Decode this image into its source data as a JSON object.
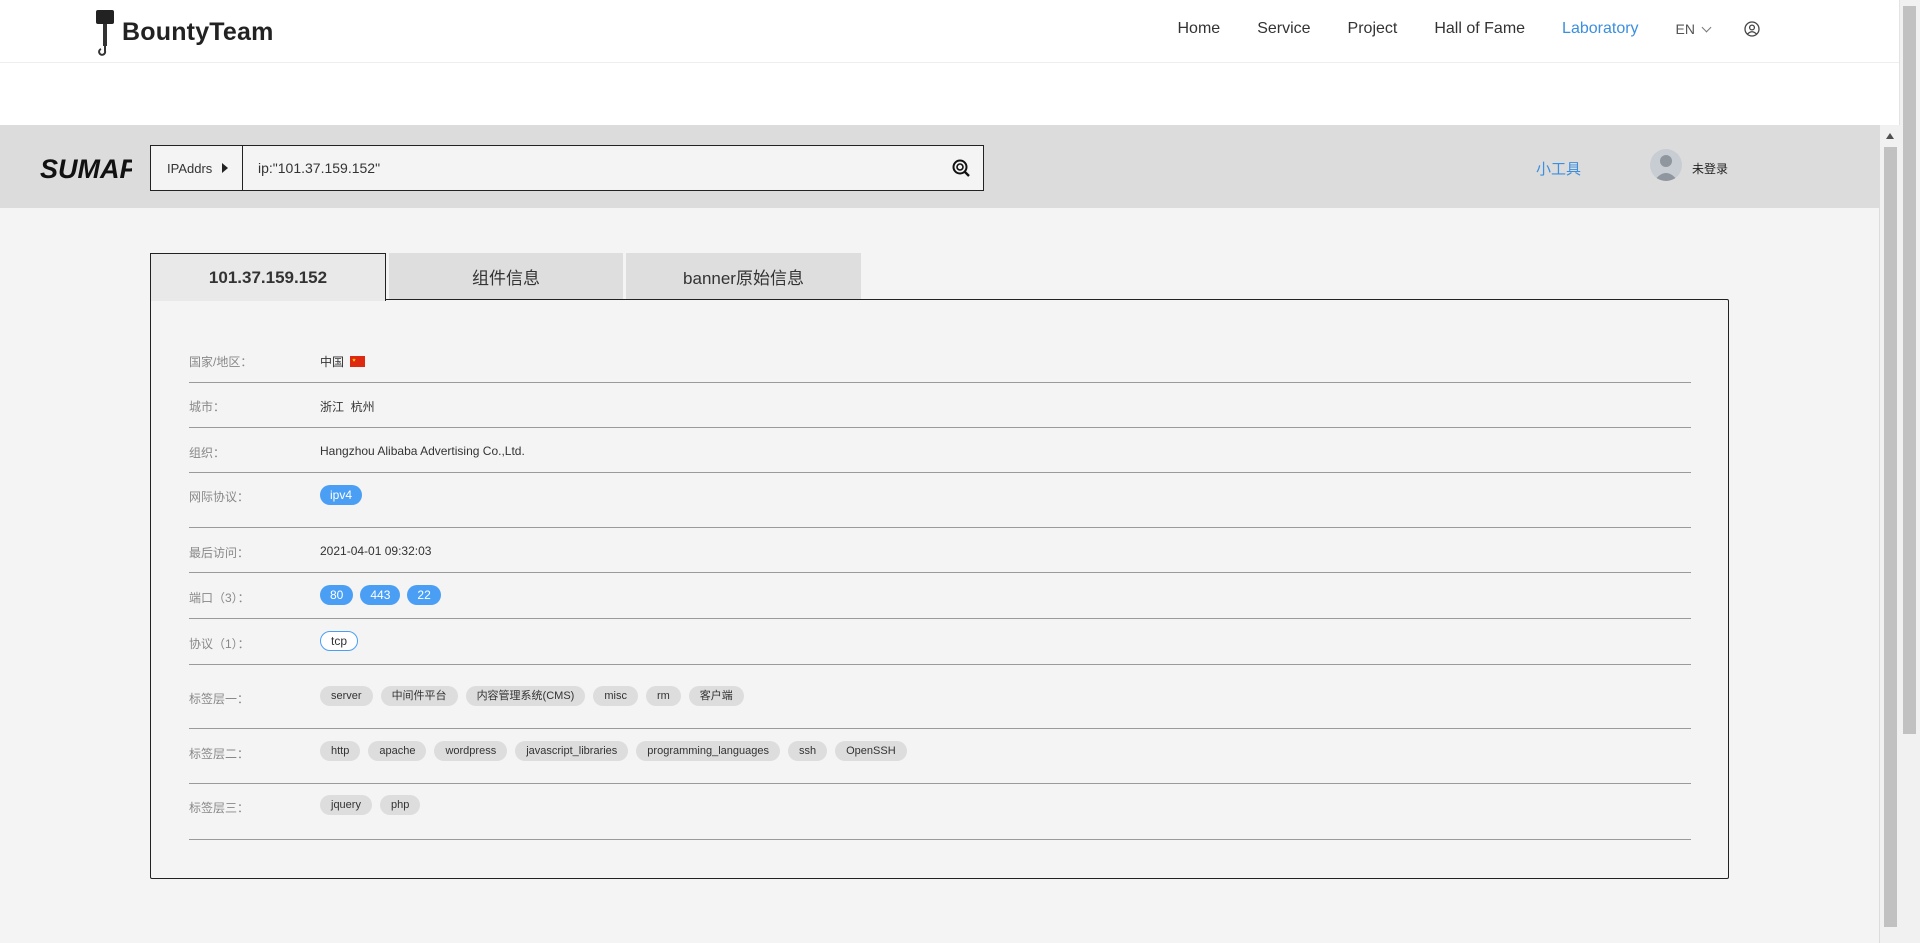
{
  "site": {
    "brand": "BountyTeam",
    "nav": [
      "Home",
      "Service",
      "Project",
      "Hall of Fame",
      "Laboratory"
    ],
    "active_nav": "Laboratory",
    "lang": "EN"
  },
  "search": {
    "logo": "SUMAP",
    "type": "IPAddrs",
    "query": "ip:\"101.37.159.152\"",
    "tools": "小工具",
    "login": "未登录"
  },
  "tabs": [
    "101.37.159.152",
    "组件信息",
    "banner原始信息"
  ],
  "info": {
    "country_label": "国家/地区：",
    "country": "中国",
    "city_label": "城市：",
    "city": "浙江  杭州",
    "org_label": "组织：",
    "org": "Hangzhou Alibaba Advertising Co.,Ltd.",
    "ip_protocol_label": "网际协议：",
    "ip_protocol": "ipv4",
    "last_visit_label": "最后访问：",
    "last_visit": "2021-04-01 09:32:03",
    "ports_label": "端口（3）：",
    "ports": [
      "80",
      "443",
      "22"
    ],
    "protocols_label": "协议（1）：",
    "protocols": [
      "tcp"
    ],
    "tag_layer1_label": "标签层一：",
    "tag_layer1": [
      "server",
      "中间件平台",
      "内容管理系统(CMS)",
      "misc",
      "rm",
      "客户端"
    ],
    "tag_layer2_label": "标签层二：",
    "tag_layer2": [
      "http",
      "apache",
      "wordpress",
      "javascript_libraries",
      "programming_languages",
      "ssh",
      "OpenSSH"
    ],
    "tag_layer3_label": "标签层三：",
    "tag_layer3": [
      "jquery",
      "php"
    ]
  },
  "colors": {
    "accent": "#3b8fde",
    "pill": "#4a9ff5",
    "tag": "#dddddd"
  }
}
